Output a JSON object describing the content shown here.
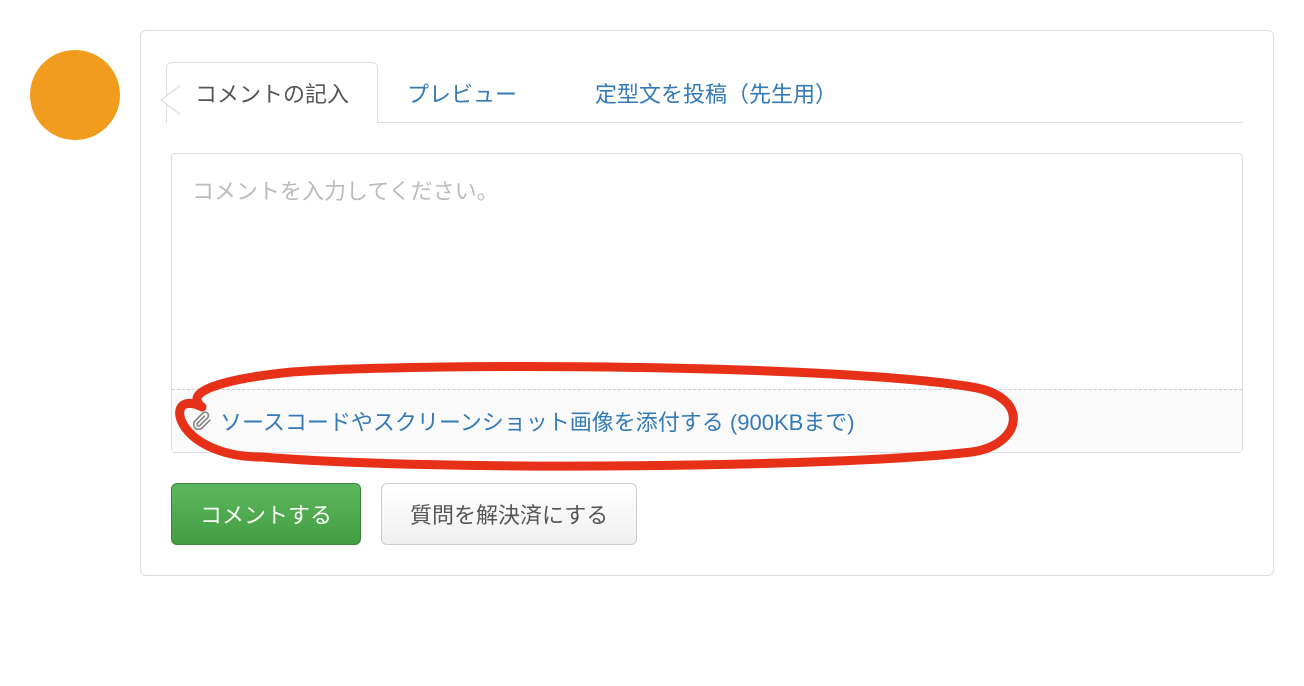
{
  "tabs": {
    "write": "コメントの記入",
    "preview": "プレビュー",
    "template": "定型文を投稿（先生用）"
  },
  "textarea": {
    "placeholder": "コメントを入力してください。"
  },
  "attach": {
    "label": "ソースコードやスクリーンショット画像を添付する (900KBまで)"
  },
  "buttons": {
    "submit": "コメントする",
    "resolve": "質問を解決済にする"
  }
}
